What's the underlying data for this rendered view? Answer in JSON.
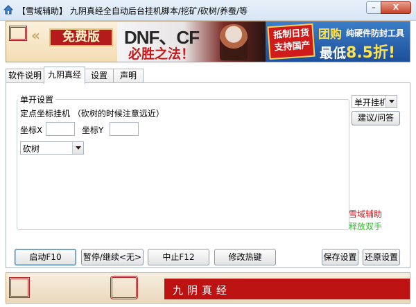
{
  "window": {
    "title": "【雪域辅助】 九阴真经全自动后台挂机脚本/挖矿/砍树/养蚕/等",
    "min_label": "–",
    "close_label": "X"
  },
  "banner": {
    "free_label": "免费版",
    "game_title": "DNF、CF",
    "slogan": "必胜之法！",
    "resist_label": "抵制日货 支持国产",
    "group_buy": "团购",
    "tool_label": "纯硬件防封工具",
    "price_prefix": "最低",
    "price_value": "8.5折!"
  },
  "tabs": [
    {
      "label": "软件说明",
      "active": false
    },
    {
      "label": "九阴真经",
      "active": true
    },
    {
      "label": "设置",
      "active": false
    },
    {
      "label": "声明",
      "active": false
    }
  ],
  "single": {
    "group_title": "单开设置",
    "description": "定点坐标挂机 （砍树的时候注意远近）",
    "coord_x_label": "坐标X",
    "coord_y_label": "坐标Y",
    "coord_x_value": "",
    "coord_y_value": "",
    "action_selected": "砍树"
  },
  "side": {
    "mode_selected": "单开挂机",
    "ask_button": "建议/问答",
    "brand_red": "雪域辅助",
    "brand_green": "释放双手"
  },
  "buttons": {
    "start": "启动F10",
    "pause": "暂停/继续<无>",
    "stop": "中止F12",
    "hotkey": "修改热键",
    "save": "保存设置",
    "restore": "还原设置"
  },
  "footer": {
    "title": "九阴真经"
  },
  "colors": {
    "accent_red": "#bd1212",
    "brand_red": "#e0141b",
    "brand_green": "#25c820"
  }
}
